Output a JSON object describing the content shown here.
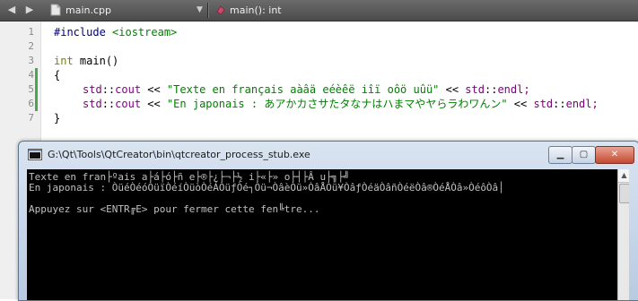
{
  "toolbar": {
    "file_name": "main.cpp",
    "function_name": "main(): int",
    "back_icon": "arrow-left-icon",
    "forward_icon": "arrow-right-icon",
    "file_icon": "cpp-file-icon",
    "function_icon": "function-symbol-icon"
  },
  "editor": {
    "line_numbers": [
      "1",
      "2",
      "3",
      "4",
      "5",
      "6",
      "7"
    ],
    "line1": {
      "directive": "#include",
      "header": "<iostream>"
    },
    "line3": {
      "type": "int",
      "name": "main()"
    },
    "line4": "{",
    "line5": {
      "ns": "std",
      "sep": "::",
      "call": "cout",
      "op": " << ",
      "string": "\"Texte en français aàâä eéèêë iîï oôö uûü\"",
      "end_ns": "std",
      "end": "endl;"
    },
    "line6": {
      "ns": "std",
      "sep": "::",
      "call": "cout",
      "op": " << ",
      "string": "\"En japonais : あアかカさサたタなナはハまマやヤらラわワんン\"",
      "end_ns": "std",
      "end": "endl;"
    },
    "line7": "}"
  },
  "console": {
    "title": "G:\\Qt\\Tools\\QtCreator\\bin\\qtcreator_process_stub.exe",
    "lines": [
      "Texte en fran├ºais a├á├ó├ñ e├®├¿├¬├½ i├«├» o├┤├Â u├╗├╝",
      "En japonais : ÒüéÒéóÒüïÒéíÒüòÒéÁÒüƒÒé┐Òü¬ÒâèÒü»ÒâÅÒü¥ÒâƒÒéäÒâñÒéëÒâ®ÒéÅÒâ»ÒéôÒâ│",
      "",
      "Appuyez sur <ENTR╔E> pour fermer cette fen╚tre..."
    ],
    "minimize_label": "▁",
    "maximize_label": "▢",
    "close_label": "✕"
  }
}
